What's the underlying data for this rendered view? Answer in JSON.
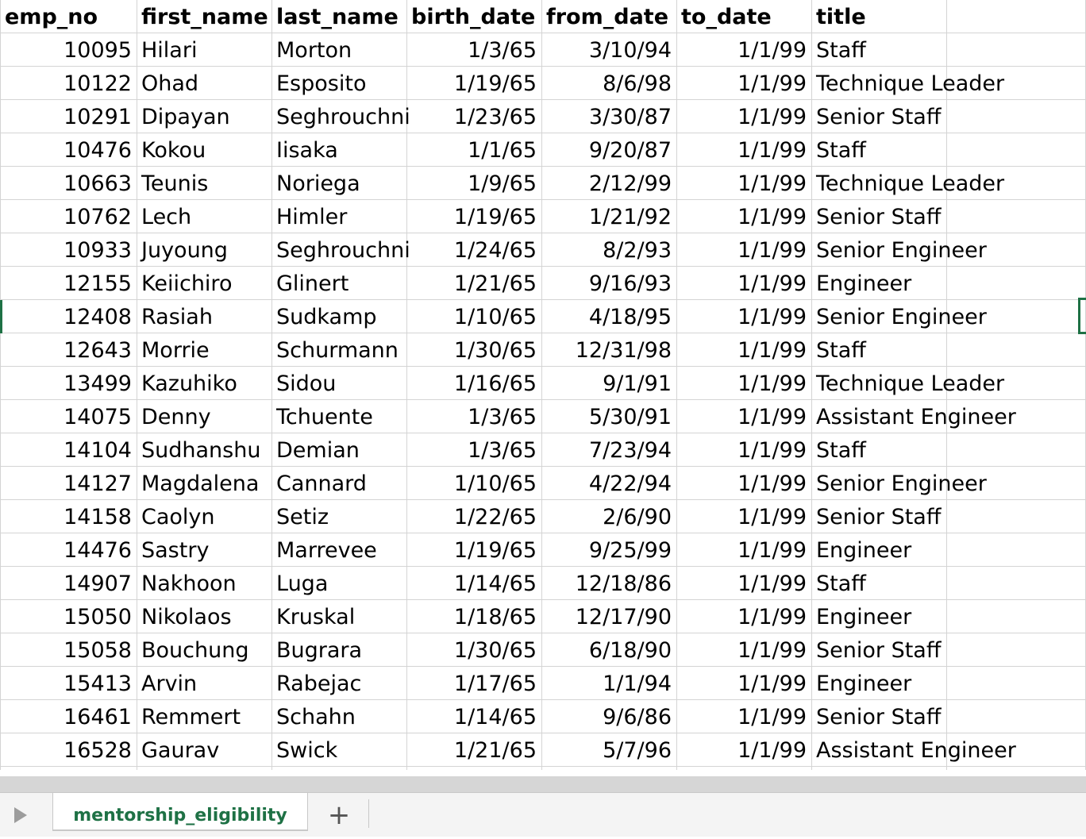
{
  "sheet": {
    "columns": [
      "emp_no",
      "first_name",
      "last_name",
      "birth_date",
      "from_date",
      "to_date",
      "title"
    ],
    "rows": [
      [
        "10095",
        "Hilari",
        "Morton",
        "1/3/65",
        "3/10/94",
        "1/1/99",
        "Staff"
      ],
      [
        "10122",
        "Ohad",
        "Esposito",
        "1/19/65",
        "8/6/98",
        "1/1/99",
        "Technique Leader"
      ],
      [
        "10291",
        "Dipayan",
        "Seghrouchni",
        "1/23/65",
        "3/30/87",
        "1/1/99",
        "Senior Staff"
      ],
      [
        "10476",
        "Kokou",
        "Iisaka",
        "1/1/65",
        "9/20/87",
        "1/1/99",
        "Staff"
      ],
      [
        "10663",
        "Teunis",
        "Noriega",
        "1/9/65",
        "2/12/99",
        "1/1/99",
        "Technique Leader"
      ],
      [
        "10762",
        "Lech",
        "Himler",
        "1/19/65",
        "1/21/92",
        "1/1/99",
        "Senior Staff"
      ],
      [
        "10933",
        "Juyoung",
        "Seghrouchni",
        "1/24/65",
        "8/2/93",
        "1/1/99",
        "Senior Engineer"
      ],
      [
        "12155",
        "Keiichiro",
        "Glinert",
        "1/21/65",
        "9/16/93",
        "1/1/99",
        "Engineer"
      ],
      [
        "12408",
        "Rasiah",
        "Sudkamp",
        "1/10/65",
        "4/18/95",
        "1/1/99",
        "Senior Engineer"
      ],
      [
        "12643",
        "Morrie",
        "Schurmann",
        "1/30/65",
        "12/31/98",
        "1/1/99",
        "Staff"
      ],
      [
        "13499",
        "Kazuhiko",
        "Sidou",
        "1/16/65",
        "9/1/91",
        "1/1/99",
        "Technique Leader"
      ],
      [
        "14075",
        "Denny",
        "Tchuente",
        "1/3/65",
        "5/30/91",
        "1/1/99",
        "Assistant Engineer"
      ],
      [
        "14104",
        "Sudhanshu",
        "Demian",
        "1/3/65",
        "7/23/94",
        "1/1/99",
        "Staff"
      ],
      [
        "14127",
        "Magdalena",
        "Cannard",
        "1/10/65",
        "4/22/94",
        "1/1/99",
        "Senior Engineer"
      ],
      [
        "14158",
        "Caolyn",
        "Setiz",
        "1/22/65",
        "2/6/90",
        "1/1/99",
        "Senior Staff"
      ],
      [
        "14476",
        "Sastry",
        "Marrevee",
        "1/19/65",
        "9/25/99",
        "1/1/99",
        "Engineer"
      ],
      [
        "14907",
        "Nakhoon",
        "Luga",
        "1/14/65",
        "12/18/86",
        "1/1/99",
        "Staff"
      ],
      [
        "15050",
        "Nikolaos",
        "Kruskal",
        "1/18/65",
        "12/17/90",
        "1/1/99",
        "Engineer"
      ],
      [
        "15058",
        "Bouchung",
        "Bugrara",
        "1/30/65",
        "6/18/90",
        "1/1/99",
        "Senior Staff"
      ],
      [
        "15413",
        "Arvin",
        "Rabejac",
        "1/17/65",
        "1/1/94",
        "1/1/99",
        "Engineer"
      ],
      [
        "16461",
        "Remmert",
        "Schahn",
        "1/14/65",
        "9/6/86",
        "1/1/99",
        "Senior Staff"
      ],
      [
        "16528",
        "Gaurav",
        "Swick",
        "1/21/65",
        "5/7/96",
        "1/1/99",
        "Assistant Engineer"
      ]
    ]
  },
  "tabbar": {
    "active_sheet": "mentorship_eligibility",
    "add_sheet_label": "+"
  },
  "colors": {
    "accent": "#1e7145",
    "gridline": "#d4d4d4"
  },
  "icons": {
    "sheet_nav": "play-triangle-icon",
    "add_sheet": "plus-icon"
  }
}
